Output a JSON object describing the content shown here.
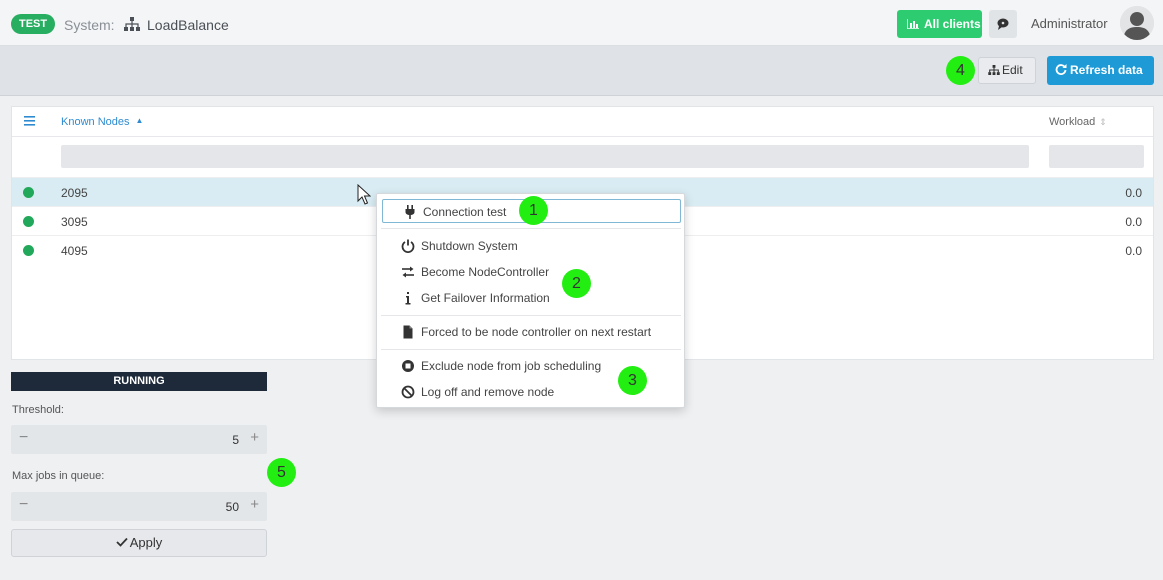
{
  "header": {
    "env_badge": "TEST",
    "system_label": "System:",
    "system_name": "LoadBalance",
    "all_clients_label": "All clients",
    "user_name": "Administrator"
  },
  "toolbar": {
    "edit_label": "Edit",
    "refresh_label": "Refresh data"
  },
  "table": {
    "col_nodes": "Known Nodes",
    "col_workload": "Workload",
    "rows": [
      {
        "node": "2095",
        "workload": "0.0"
      },
      {
        "node": "3095",
        "workload": "0.0"
      },
      {
        "node": "4095",
        "workload": "0.0"
      }
    ]
  },
  "controls": {
    "status": "RUNNING",
    "threshold_label": "Threshold:",
    "threshold_value": "5",
    "max_jobs_label": "Max jobs in queue:",
    "max_jobs_value": "50",
    "apply_label": "Apply"
  },
  "context_menu": {
    "items": [
      {
        "label": "Connection test",
        "icon": "plug-icon"
      },
      {
        "label": "Shutdown System",
        "icon": "power-icon"
      },
      {
        "label": "Become NodeController",
        "icon": "exchange-icon"
      },
      {
        "label": "Get Failover Information",
        "icon": "info-icon"
      },
      {
        "label": "Forced to be node controller on next restart",
        "icon": "file-icon"
      },
      {
        "label": "Exclude node from job scheduling",
        "icon": "stop-circle-icon"
      },
      {
        "label": "Log off and remove node",
        "icon": "ban-icon"
      }
    ]
  },
  "callouts": [
    "1",
    "2",
    "3",
    "4",
    "5"
  ],
  "colors": {
    "accent_green": "#2ecc71",
    "accent_blue": "#1e9bd7",
    "status_dark": "#1e2a3a",
    "callout": "#22ee11"
  }
}
